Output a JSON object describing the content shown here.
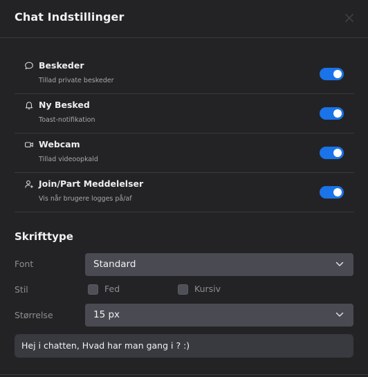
{
  "dialog": {
    "title": "Chat Indstillinger",
    "close_icon": "close-icon"
  },
  "settings": [
    {
      "icon": "chat-bubble-icon",
      "label": "Beskeder",
      "description": "Tillad private beskeder",
      "enabled": true
    },
    {
      "icon": "bell-icon",
      "label": "Ny Besked",
      "description": "Toast-notifikation",
      "enabled": true
    },
    {
      "icon": "video-camera-icon",
      "label": "Webcam",
      "description": "Tillad videoopkald",
      "enabled": true
    },
    {
      "icon": "user-plus-icon",
      "label": "Join/Part Meddelelser",
      "description": "Vis når brugere logges på/af",
      "enabled": true
    }
  ],
  "font_section": {
    "title": "Skrifttype",
    "font_label": "Font",
    "font_value": "Standard",
    "style_label": "Stil",
    "bold_label": "Fed",
    "bold_checked": false,
    "italic_label": "Kursiv",
    "italic_checked": false,
    "size_label": "Størrelse",
    "size_value": "15 px",
    "preview_text": "Hej i chatten, Hvad har man gang i ? :)"
  },
  "colors": {
    "background": "#232325",
    "accent": "#1a73e8",
    "select_bg": "#4a4b52",
    "preview_bg": "#393a3f"
  }
}
